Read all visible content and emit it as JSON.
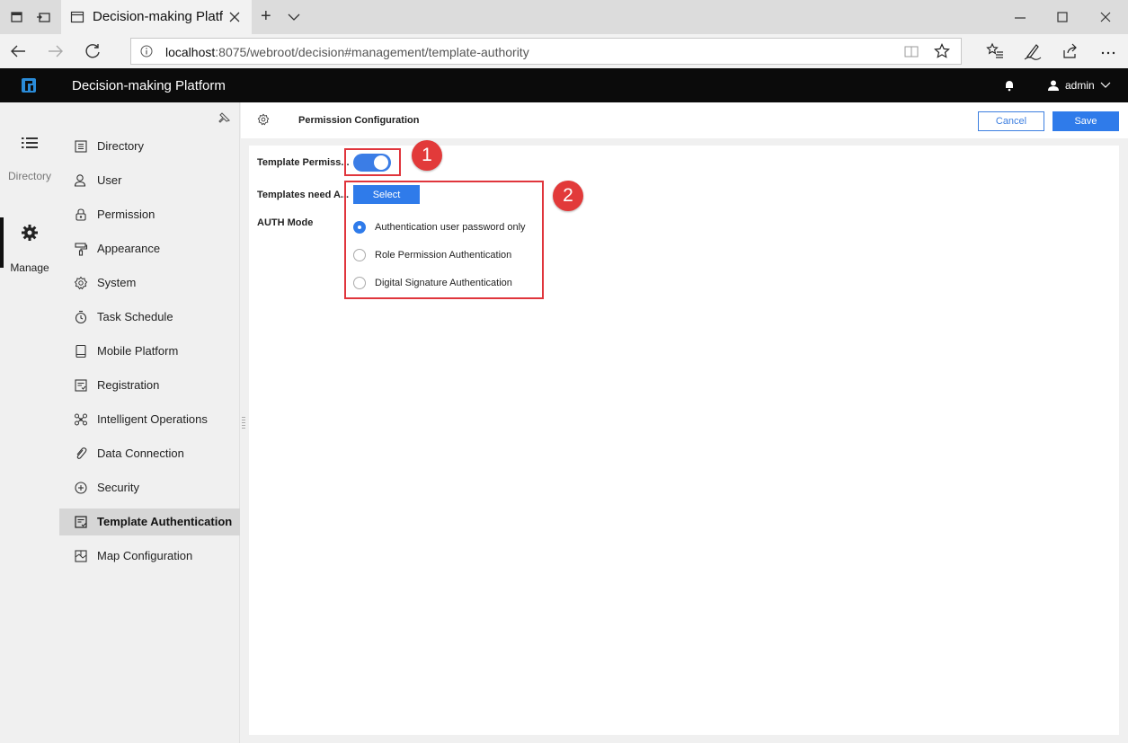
{
  "browser": {
    "tab_title": "Decision-making Platfor",
    "new_tab_symbol": "+",
    "url_host": "localhost",
    "url_rest": ":8075/webroot/decision#management/template-authority"
  },
  "app": {
    "title": "Decision-making Platform",
    "user": "admin"
  },
  "rail": {
    "items": [
      {
        "label": "Directory",
        "icon": "list-icon"
      },
      {
        "label": "Manage",
        "icon": "gear-icon"
      }
    ]
  },
  "menu": {
    "items": [
      {
        "label": "Directory",
        "icon": "directory-icon"
      },
      {
        "label": "User",
        "icon": "user-icon"
      },
      {
        "label": "Permission",
        "icon": "lock-icon"
      },
      {
        "label": "Appearance",
        "icon": "paint-roller-icon"
      },
      {
        "label": "System",
        "icon": "settings-icon"
      },
      {
        "label": "Task Schedule",
        "icon": "timer-icon"
      },
      {
        "label": "Mobile Platform",
        "icon": "mobile-icon"
      },
      {
        "label": "Registration",
        "icon": "registration-icon"
      },
      {
        "label": "Intelligent Operations",
        "icon": "network-icon"
      },
      {
        "label": "Data Connection",
        "icon": "link-icon"
      },
      {
        "label": "Security",
        "icon": "shield-icon"
      },
      {
        "label": "Template Authentication",
        "icon": "template-auth-icon",
        "active": true
      },
      {
        "label": "Map Configuration",
        "icon": "map-icon"
      }
    ]
  },
  "page": {
    "title": "Permission Configuration",
    "cancel_label": "Cancel",
    "save_label": "Save"
  },
  "form": {
    "template_permission_label": "Template Permiss...",
    "template_permission_enabled": true,
    "templates_need_auth_label": "Templates need A...",
    "select_label": "Select",
    "auth_mode_label": "AUTH Mode",
    "auth_options": [
      {
        "label": "Authentication user password only",
        "checked": true
      },
      {
        "label": "Role Permission Authentication",
        "checked": false
      },
      {
        "label": "Digital Signature Authentication",
        "checked": false
      }
    ]
  },
  "annotations": {
    "badge_1": "1",
    "badge_2": "2",
    "color": "#e0353c"
  },
  "colors": {
    "accent": "#2f7bea",
    "header": "#0b0b0b"
  }
}
